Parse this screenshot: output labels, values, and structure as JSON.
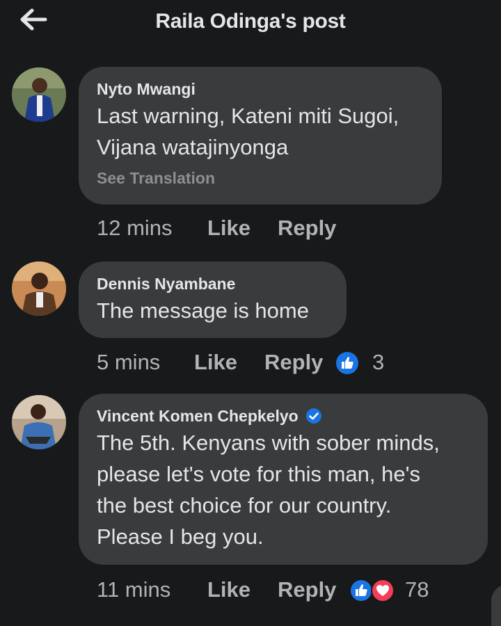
{
  "header": {
    "title": "Raila Odinga's post",
    "back_icon": "arrow-left-icon"
  },
  "comments": [
    {
      "author": "Nyto Mwangi",
      "text_line1": "Last warning, Kateni miti Sugoi,",
      "text_line2": "Vijana watajinyonga",
      "see_translation": "See Translation",
      "time": "12 mins",
      "like": "Like",
      "reply": "Reply"
    },
    {
      "author": "Dennis Nyambane",
      "text_line1": "The message is home",
      "time": "5 mins",
      "like": "Like",
      "reply": "Reply",
      "reaction_count": "3",
      "reactions": [
        "like-reaction-icon"
      ]
    },
    {
      "author": "Vincent Komen Chepkelyo",
      "verified": true,
      "text_line1": "The 5th. Kenyans with sober minds,",
      "text_line2": "please let's vote for this man, he's",
      "text_line3": "the best choice for our country.",
      "text_line4": "Please I beg you.",
      "time": "11 mins",
      "like": "Like",
      "reply": "Reply",
      "reaction_count": "78",
      "reactions": [
        "like-reaction-icon",
        "love-reaction-icon"
      ]
    }
  ],
  "colors": {
    "background": "#18191a",
    "bubble": "#3a3b3c",
    "text": "#e4e6eb",
    "secondary_text": "#b0b3b8",
    "like_blue": "#1b74e4",
    "love_red": "#f33e58"
  }
}
